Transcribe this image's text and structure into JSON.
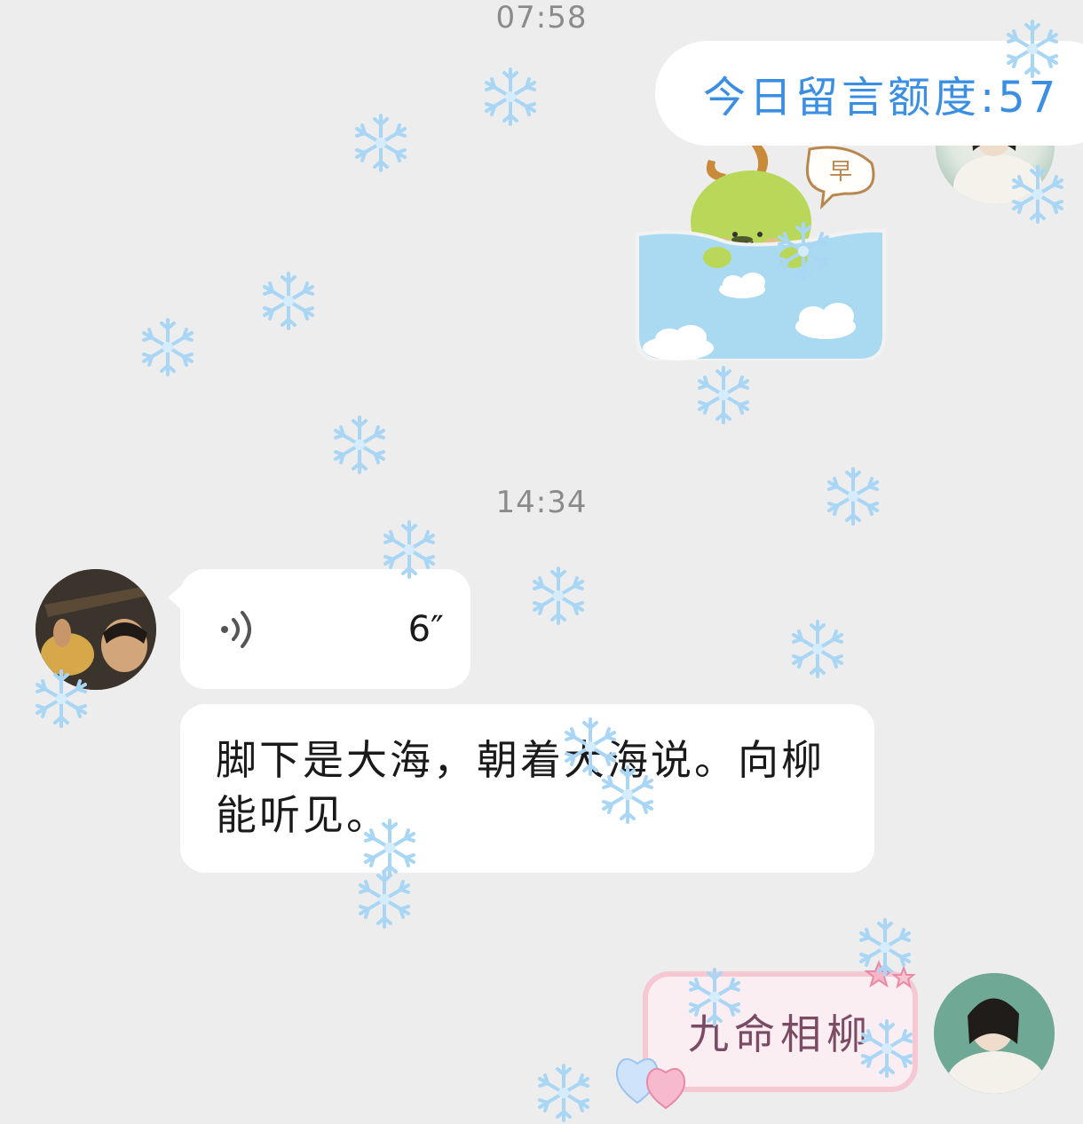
{
  "chat": {
    "timestamps": [
      "07:58",
      "14:34"
    ],
    "quota_label": "今日留言额度:57",
    "voice_message": {
      "duration": "6″"
    },
    "text_message": "脚下是大海，朝着大海说。向柳能听见。",
    "name_bubble_text": "九命相柳"
  },
  "icons": {
    "voice": "voice-wave-icon",
    "snowflake": "snowflake-icon",
    "heart": "heart-icon",
    "star": "star-icon"
  },
  "colors": {
    "background": "#ededed",
    "quota_text": "#3b8fe3",
    "bubble": "#ffffff",
    "name_bubble_fill": "#fbeef2",
    "name_bubble_border": "#f6c8d4",
    "snowflake": "#a9d6f5"
  }
}
